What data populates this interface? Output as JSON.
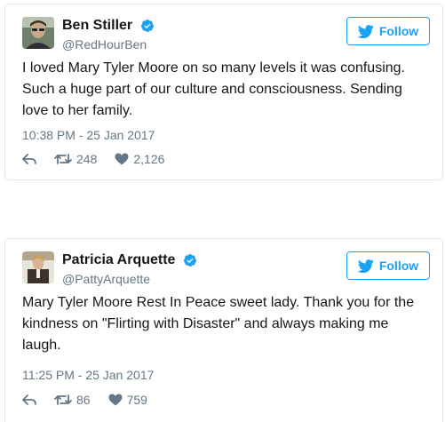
{
  "colors": {
    "accent": "#1da1f2",
    "text": "#14171a",
    "muted": "#657786",
    "border": "#e1e8ed"
  },
  "tweets": [
    {
      "display_name": "Ben Stiller",
      "handle": "@RedHourBen",
      "verified": true,
      "avatar": "user-photo-icon",
      "follow_label": "Follow",
      "text": "I loved Mary Tyler Moore on so many levels it was confusing. Such a huge part of our culture and consciousness. Sending love to her family.",
      "timestamp": "10:38 PM - 25 Jan 2017",
      "retweets": "248",
      "likes": "2,126"
    },
    {
      "display_name": "Patricia Arquette",
      "handle": "@PattyArquette",
      "verified": true,
      "avatar": "user-photo-icon",
      "follow_label": "Follow",
      "text": "Mary Tyler Moore Rest In Peace sweet lady. Thank you for the kindness on \"Flirting with Disaster\" and always making me laugh.",
      "timestamp": "11:25 PM - 25 Jan 2017",
      "retweets": "86",
      "likes": "759"
    }
  ]
}
